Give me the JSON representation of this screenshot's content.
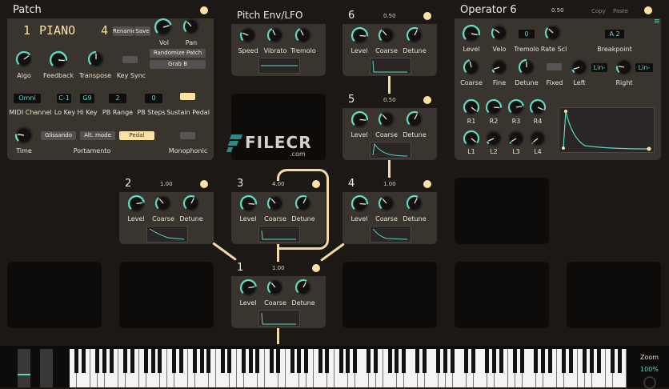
{
  "colors": {
    "accent": "#5fd9c4",
    "led": "#fbe1a2",
    "panel": "#3a342f",
    "header": "#1c1815",
    "wire": "#f2d9a4"
  },
  "patch": {
    "title": "Patch",
    "patch_number": "1",
    "patch_name": "PIANO",
    "algorithm": "4",
    "rename_label": "Rename",
    "save_label": "Save",
    "vol_label": "Vol",
    "pan_label": "Pan",
    "randomize_label": "Randomize Patch",
    "grab_label": "Grab B",
    "algo_label": "Algo",
    "feedback_label": "Feedback",
    "transpose_label": "Transpose",
    "key_sync_label": "Key Sync",
    "midi_channel": "Omni",
    "lo_key": "C-1",
    "hi_key": "G9",
    "pb_range": "2",
    "pb_steps": "0",
    "midi_channel_label": "MIDI Channel",
    "lo_key_label": "Lo Key",
    "hi_key_label": "Hi Key",
    "pb_range_label": "PB Range",
    "pb_steps_label": "PB Steps",
    "sustain_label": "Sustain Pedal",
    "glissando_label": "Glissando",
    "alt_mode_label": "Alt. mode",
    "pedal_label": "Pedal",
    "time_label": "Time",
    "portamento_label": "Portamento",
    "monophonic_label": "Monophonic"
  },
  "pitch_env": {
    "title": "Pitch Env/LFO",
    "speed_label": "Speed",
    "vibrato_label": "Vibrato",
    "tremolo_label": "Tremolo"
  },
  "operators": [
    {
      "num": "6",
      "ratio": "0.50"
    },
    {
      "num": "5",
      "ratio": "0.50"
    },
    {
      "num": "2",
      "ratio": "1.00"
    },
    {
      "num": "3",
      "ratio": "4.00"
    },
    {
      "num": "4",
      "ratio": "1.00"
    },
    {
      "num": "1",
      "ratio": "1.00"
    }
  ],
  "op_labels": {
    "level": "Level",
    "coarse": "Coarse",
    "detune": "Detune"
  },
  "operator_detail": {
    "title": "Operator 6",
    "ratio": "0.50",
    "copy_label": "Copy",
    "paste_label": "Paste",
    "level_label": "Level",
    "velo_label": "Velo",
    "tremolo_value": "0",
    "tremolo_label": "Tremolo",
    "rate_scl_label": "Rate Scl",
    "breakpoint_value": "A 2",
    "breakpoint_label": "Breakpoint",
    "coarse_label": "Coarse",
    "fine_label": "Fine",
    "detune_label": "Detune",
    "fixed_label": "Fixed",
    "left_curve": "Lin-",
    "left_label": "Left",
    "right_curve": "Lin-",
    "right_label": "Right",
    "r1": "R1",
    "r2": "R2",
    "r3": "R3",
    "r4": "R4",
    "l1": "L1",
    "l2": "L2",
    "l3": "L3",
    "l4": "L4"
  },
  "watermark": {
    "brand": "FILECR",
    ".com": ".com"
  },
  "keyboard": {
    "zoom_label": "Zoom",
    "zoom_value": "100%"
  }
}
